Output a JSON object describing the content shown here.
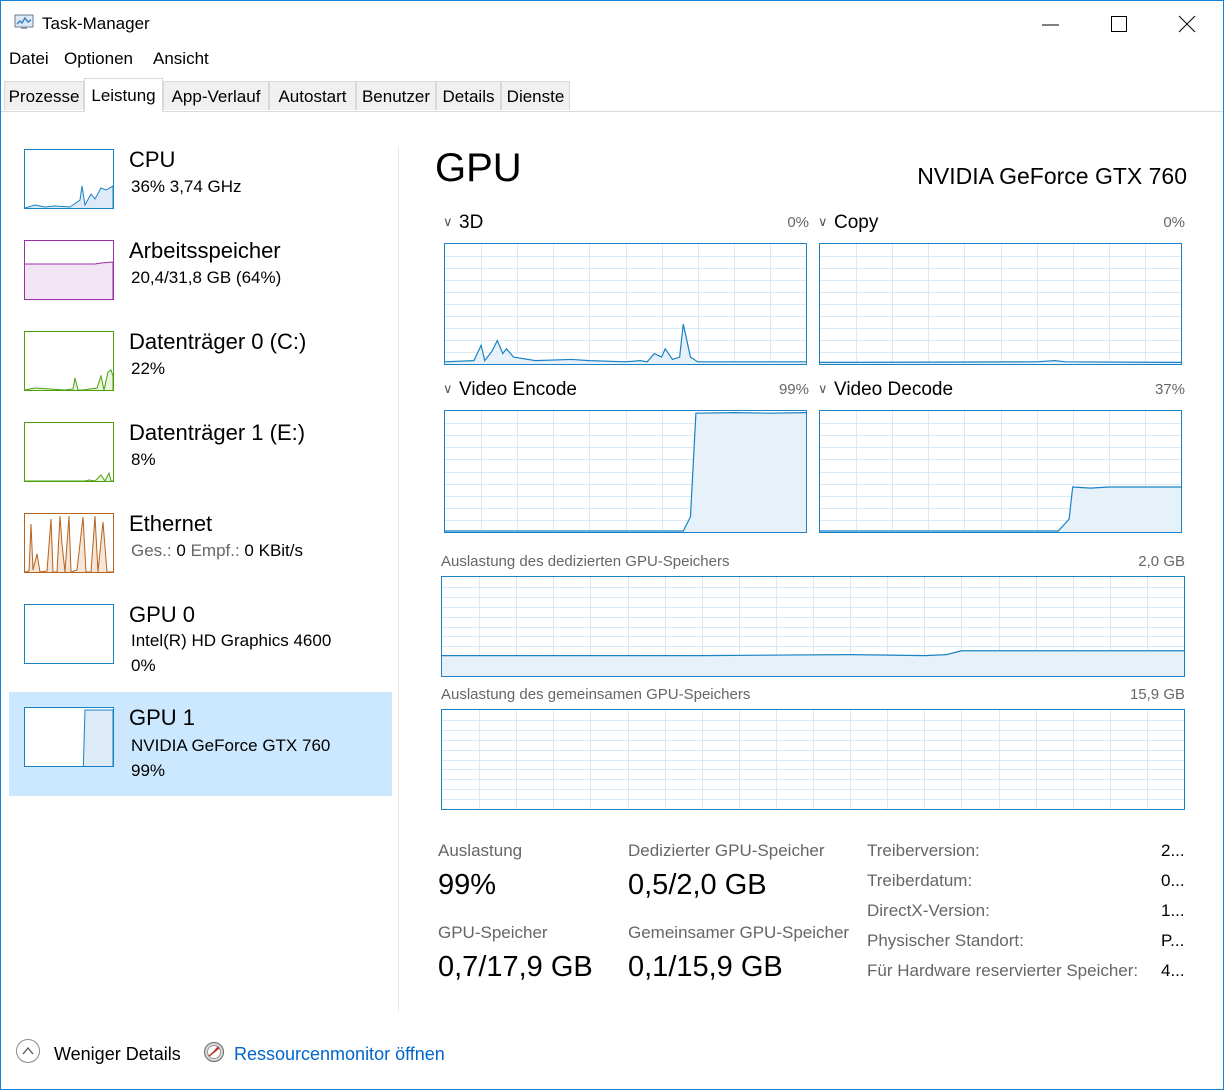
{
  "window": {
    "title": "Task-Manager"
  },
  "menu": {
    "items": [
      "Datei",
      "Optionen",
      "Ansicht"
    ]
  },
  "tabs": [
    "Prozesse",
    "Leistung",
    "App-Verlauf",
    "Autostart",
    "Benutzer",
    "Details",
    "Dienste"
  ],
  "active_tab": "Leistung",
  "sidebar": {
    "items": [
      {
        "name": "CPU",
        "line1": "36%  3,74 GHz",
        "line2": "",
        "color": "#1a82c4",
        "level": 0.36
      },
      {
        "name": "Arbeitsspeicher",
        "line1": "20,4/31,8 GB (64%)",
        "line2": "",
        "color": "#9a2ea6",
        "level": 0.64
      },
      {
        "name": "Datenträger 0 (C:)",
        "line1": "22%",
        "line2": "",
        "color": "#4da00e",
        "level": 0.22
      },
      {
        "name": "Datenträger 1 (E:)",
        "line1": "8%",
        "line2": "",
        "color": "#4da00e",
        "level": 0.08
      },
      {
        "name": "Ethernet",
        "ges_label": "Ges.:",
        "ges_value": "0",
        "empf_label": "Empf.:",
        "empf_value": "0 KBit/s",
        "color": "#b8621c"
      },
      {
        "name": "GPU 0",
        "line1": "Intel(R) HD Graphics 4600",
        "line2": "0%",
        "color": "#1a82c4",
        "level": 0.0
      },
      {
        "name": "GPU 1",
        "line1": "NVIDIA GeForce GTX 760",
        "line2": "99%",
        "color": "#1a82c4",
        "level": 0.99,
        "selected": true
      }
    ]
  },
  "main": {
    "title": "GPU",
    "model": "NVIDIA GeForce GTX 760",
    "engines": [
      {
        "label": "3D",
        "percent": "0%"
      },
      {
        "label": "Copy",
        "percent": "0%"
      },
      {
        "label": "Video Encode",
        "percent": "99%"
      },
      {
        "label": "Video Decode",
        "percent": "37%"
      }
    ],
    "dedicated_memory": {
      "label": "Auslastung des dedizierten GPU-Speichers",
      "max": "2,0 GB"
    },
    "shared_memory": {
      "label": "Auslastung des gemeinsamen GPU-Speichers",
      "max": "15,9 GB"
    },
    "stats": {
      "utilization_label": "Auslastung",
      "utilization_value": "99%",
      "dedicated_label": "Dedizierter GPU-Speicher",
      "dedicated_value": "0,5/2,0 GB",
      "gpu_mem_label": "GPU-Speicher",
      "gpu_mem_value": "0,7/17,9 GB",
      "shared_label": "Gemeinsamer GPU-Speicher",
      "shared_value": "0,1/15,9 GB"
    },
    "info": [
      {
        "key": "Treiberversion:",
        "value": "2..."
      },
      {
        "key": "Treiberdatum:",
        "value": "0..."
      },
      {
        "key": "DirectX-Version:",
        "value": "1..."
      },
      {
        "key": "Physischer Standort:",
        "value": "P..."
      },
      {
        "key": "Für Hardware reservierter Speicher:",
        "value": "4..."
      }
    ]
  },
  "footer": {
    "fewer_details": "Weniger Details",
    "resource_monitor": "Ressourcenmonitor öffnen"
  },
  "colors": {
    "accent": "#1a82c4",
    "selection": "#cce8ff",
    "link": "#0066cc"
  }
}
